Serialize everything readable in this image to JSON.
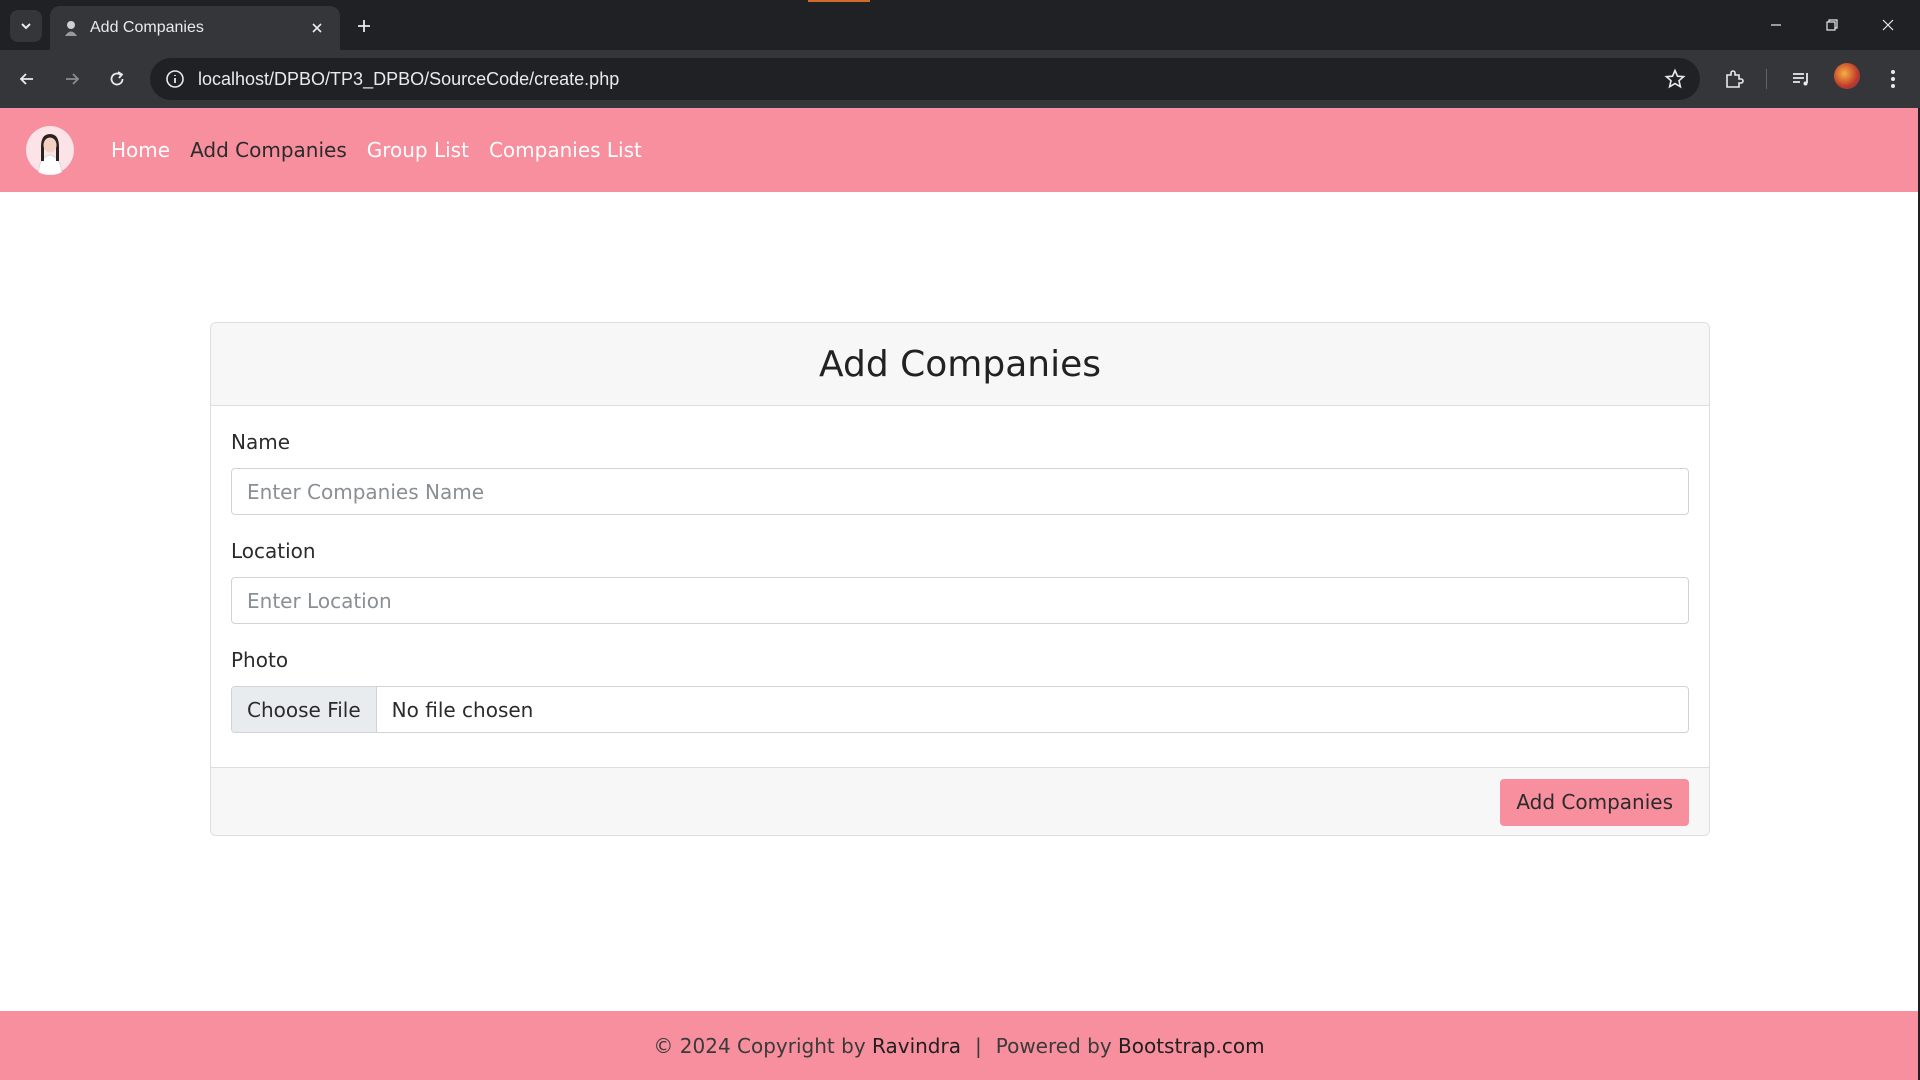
{
  "browser": {
    "tab_title": "Add Companies",
    "url": "localhost/DPBO/TP3_DPBO/SourceCode/create.php",
    "icons": {
      "tab_search": "chevron-down-icon",
      "close_tab": "close-icon",
      "new_tab": "plus-icon",
      "back": "arrow-left-icon",
      "forward": "arrow-right-icon",
      "reload": "reload-icon",
      "site_info": "info-icon",
      "bookmark": "star-icon",
      "extensions": "puzzle-icon",
      "media": "media-queue-icon",
      "menu": "kebab-menu-icon"
    }
  },
  "navbar": {
    "links": [
      "Home",
      "Add Companies",
      "Group List",
      "Companies List"
    ],
    "active_index": 1,
    "background": "#f78f9e"
  },
  "form": {
    "title": "Add Companies",
    "name_label": "Name",
    "name_placeholder": "Enter Companies Name",
    "location_label": "Location",
    "location_placeholder": "Enter Location",
    "photo_label": "Photo",
    "file_button": "Choose File",
    "file_status": "No file chosen",
    "submit_label": "Add Companies"
  },
  "footer": {
    "copyright": "© 2024 Copyright by",
    "author": "Ravindra",
    "separator": "|",
    "powered": "Powered by",
    "powered_link": "Bootstrap.com"
  }
}
